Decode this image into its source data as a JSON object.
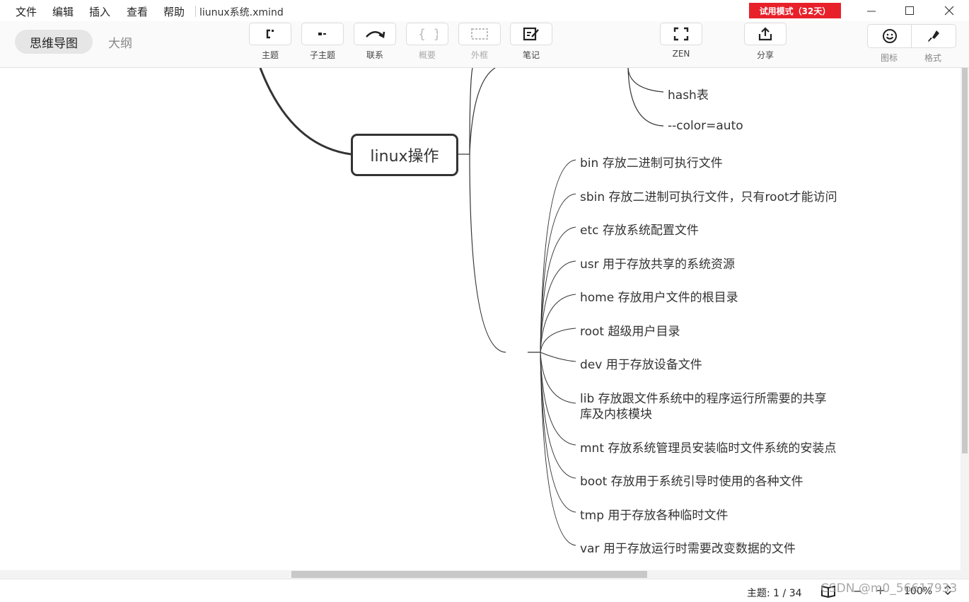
{
  "menubar": {
    "items": [
      "文件",
      "编辑",
      "插入",
      "查看",
      "帮助"
    ],
    "file_title": "liunux系统.xmind",
    "trial_badge": "试用模式（32天）"
  },
  "toolbar": {
    "view_tabs": [
      "思维导图",
      "大纲"
    ],
    "tools": [
      {
        "label": "主题",
        "icon": "topic-icon",
        "enabled": true
      },
      {
        "label": "子主题",
        "icon": "subtopic-icon",
        "enabled": true
      },
      {
        "label": "联系",
        "icon": "relationship-icon",
        "enabled": true
      },
      {
        "label": "概要",
        "icon": "summary-icon",
        "enabled": false
      },
      {
        "label": "外框",
        "icon": "boundary-icon",
        "enabled": false
      },
      {
        "label": "笔记",
        "icon": "note-icon",
        "enabled": true
      },
      {
        "label": "ZEN",
        "icon": "fullscreen-icon",
        "enabled": true
      },
      {
        "label": "分享",
        "icon": "share-icon",
        "enabled": true
      }
    ],
    "right_panels": [
      {
        "label": "图标",
        "icon": "smiley-icon"
      },
      {
        "label": "格式",
        "icon": "brush-icon"
      }
    ]
  },
  "mindmap": {
    "central": "linux操作",
    "upper_nodes": [
      "hash表",
      "--color=auto"
    ],
    "directories": [
      "bin 存放二进制可执行文件",
      "sbin 存放二进制可执行文件，只有root才能访问",
      "etc 存放系统配置文件",
      "usr 用于存放共享的系统资源",
      "home 存放用户文件的根目录",
      "root 超级用户目录",
      "dev 用于存放设备文件",
      "lib 存放跟文件系统中的程序运行所需要的共享",
      "库及内核模块",
      "mnt 存放系统管理员安装临时文件系统的安装点",
      "boot 存放用于系统引导时使用的各种文件",
      "tmp 用于存放各种临时文件",
      "var 用于存放运行时需要改变数据的文件"
    ]
  },
  "statusbar": {
    "topic_count": "主题: 1 / 34",
    "zoom": "100%",
    "watermark": "CSDN @m0_56617933"
  },
  "colors": {
    "trial_badge": "#e8202a",
    "line": "#333333"
  }
}
